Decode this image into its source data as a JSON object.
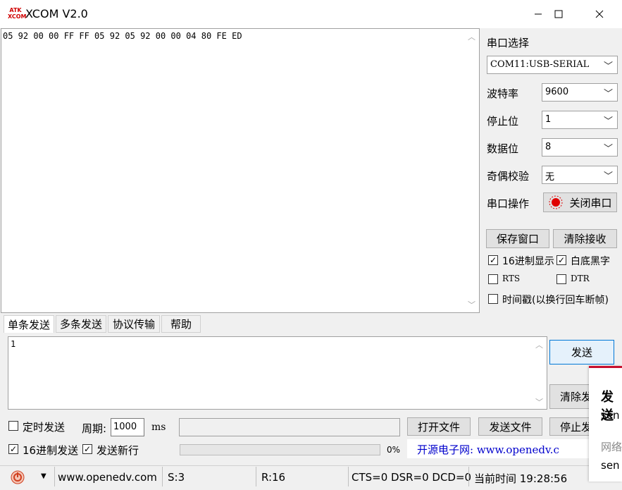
{
  "window": {
    "title": "XCOM V2.0",
    "logo_text_top": "ATK",
    "logo_text_bottom": "XCOM",
    "minimize_icon": "minimize-icon",
    "maximize_icon": "maximize-icon",
    "close_icon": "close-icon"
  },
  "receive": {
    "text": "05 92 00 00 FF FF 05 92 05 92 00 00 04 80 FE ED"
  },
  "serial": {
    "section_label": "串口选择",
    "port_value": "COM11:USB-SERIAL",
    "baud_label": "波特率",
    "baud_value": "9600",
    "stop_label": "停止位",
    "stop_value": "1",
    "data_label": "数据位",
    "data_value": "8",
    "parity_label": "奇偶校验",
    "parity_value": "无",
    "op_label": "串口操作",
    "op_button": "关闭串口",
    "save_window": "保存窗口",
    "clear_recv": "清除接收",
    "hex_display": "16进制显示",
    "white_bg": "白底黑字",
    "rts": "RTS",
    "dtr": "DTR",
    "timestamp": "时间戳(以换行回车断帧)",
    "hex_display_checked": true,
    "white_bg_checked": true,
    "rts_checked": false,
    "dtr_checked": false,
    "timestamp_checked": false
  },
  "tabs": [
    "单条发送",
    "多条发送",
    "协议传输",
    "帮助"
  ],
  "send": {
    "text": "1",
    "send_button": "发送",
    "clear_send_button": "清除发",
    "timed_send": "定时发送",
    "period_label": "周期:",
    "period_value": "1000",
    "period_unit": "ms",
    "open_file": "打开文件",
    "send_file": "发送文件",
    "stop_send": "停止发",
    "hex_send": "16进制发送",
    "send_newline": "发送新行",
    "progress_percent": "0%",
    "progress_value": 0,
    "promo": "开源电子网: www.openedv.c",
    "timed_checked": false,
    "hex_send_checked": true,
    "newline_checked": true
  },
  "status": {
    "website": "www.openedv.com",
    "sent": "S:3",
    "received": "R:16",
    "lines": "CTS=0 DSR=0 DCD=0",
    "time": "当前时间 19:28:56"
  },
  "notification": {
    "title": "发送",
    "line1": "sen",
    "line2": "网络",
    "line3": "sen"
  },
  "colors": {
    "accent": "#c8102e",
    "promo_blue": "#0000cc",
    "send_btn_bg": "#e5f1fb",
    "send_btn_border": "#0078d7"
  }
}
